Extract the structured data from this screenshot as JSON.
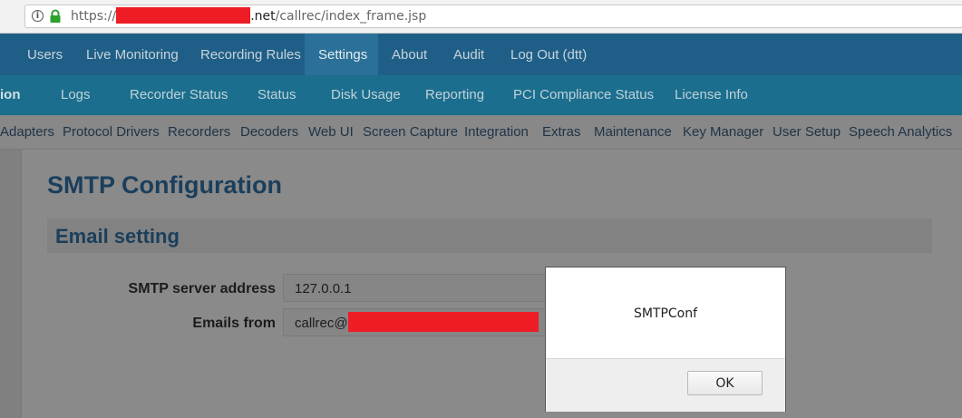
{
  "browser": {
    "url_prefix": "https://",
    "url_host_suffix": ".net",
    "url_path": "/callrec/index_frame.jsp"
  },
  "nav_primary": [
    "Users",
    "Live Monitoring",
    "Recording Rules",
    "Settings",
    "About",
    "Audit",
    "Log Out (dtt)"
  ],
  "nav_secondary": [
    "ion",
    "Logs",
    "Recorder Status",
    "Status",
    "Disk Usage",
    "Reporting",
    "PCI Compliance Status",
    "License Info"
  ],
  "nav_tertiary": [
    "Adapters",
    "Protocol Drivers",
    "Recorders",
    "Decoders",
    "Web UI",
    "Screen Capture",
    "Integration",
    "Extras",
    "Maintenance",
    "Key Manager",
    "User Setup",
    "Speech Analytics"
  ],
  "page": {
    "title": "SMTP Configuration",
    "section_title": "Email setting",
    "smtp_server_label": "SMTP server address",
    "smtp_server_value": "127.0.0.1",
    "emails_from_label": "Emails from",
    "emails_from_value": "callrec@"
  },
  "dialog": {
    "message": "SMTPConf",
    "ok_label": "OK"
  },
  "colors": {
    "nav_primary_bg": "#1f5f87",
    "nav_secondary_bg": "#1b6e8d",
    "redaction": "#ee1c25"
  }
}
